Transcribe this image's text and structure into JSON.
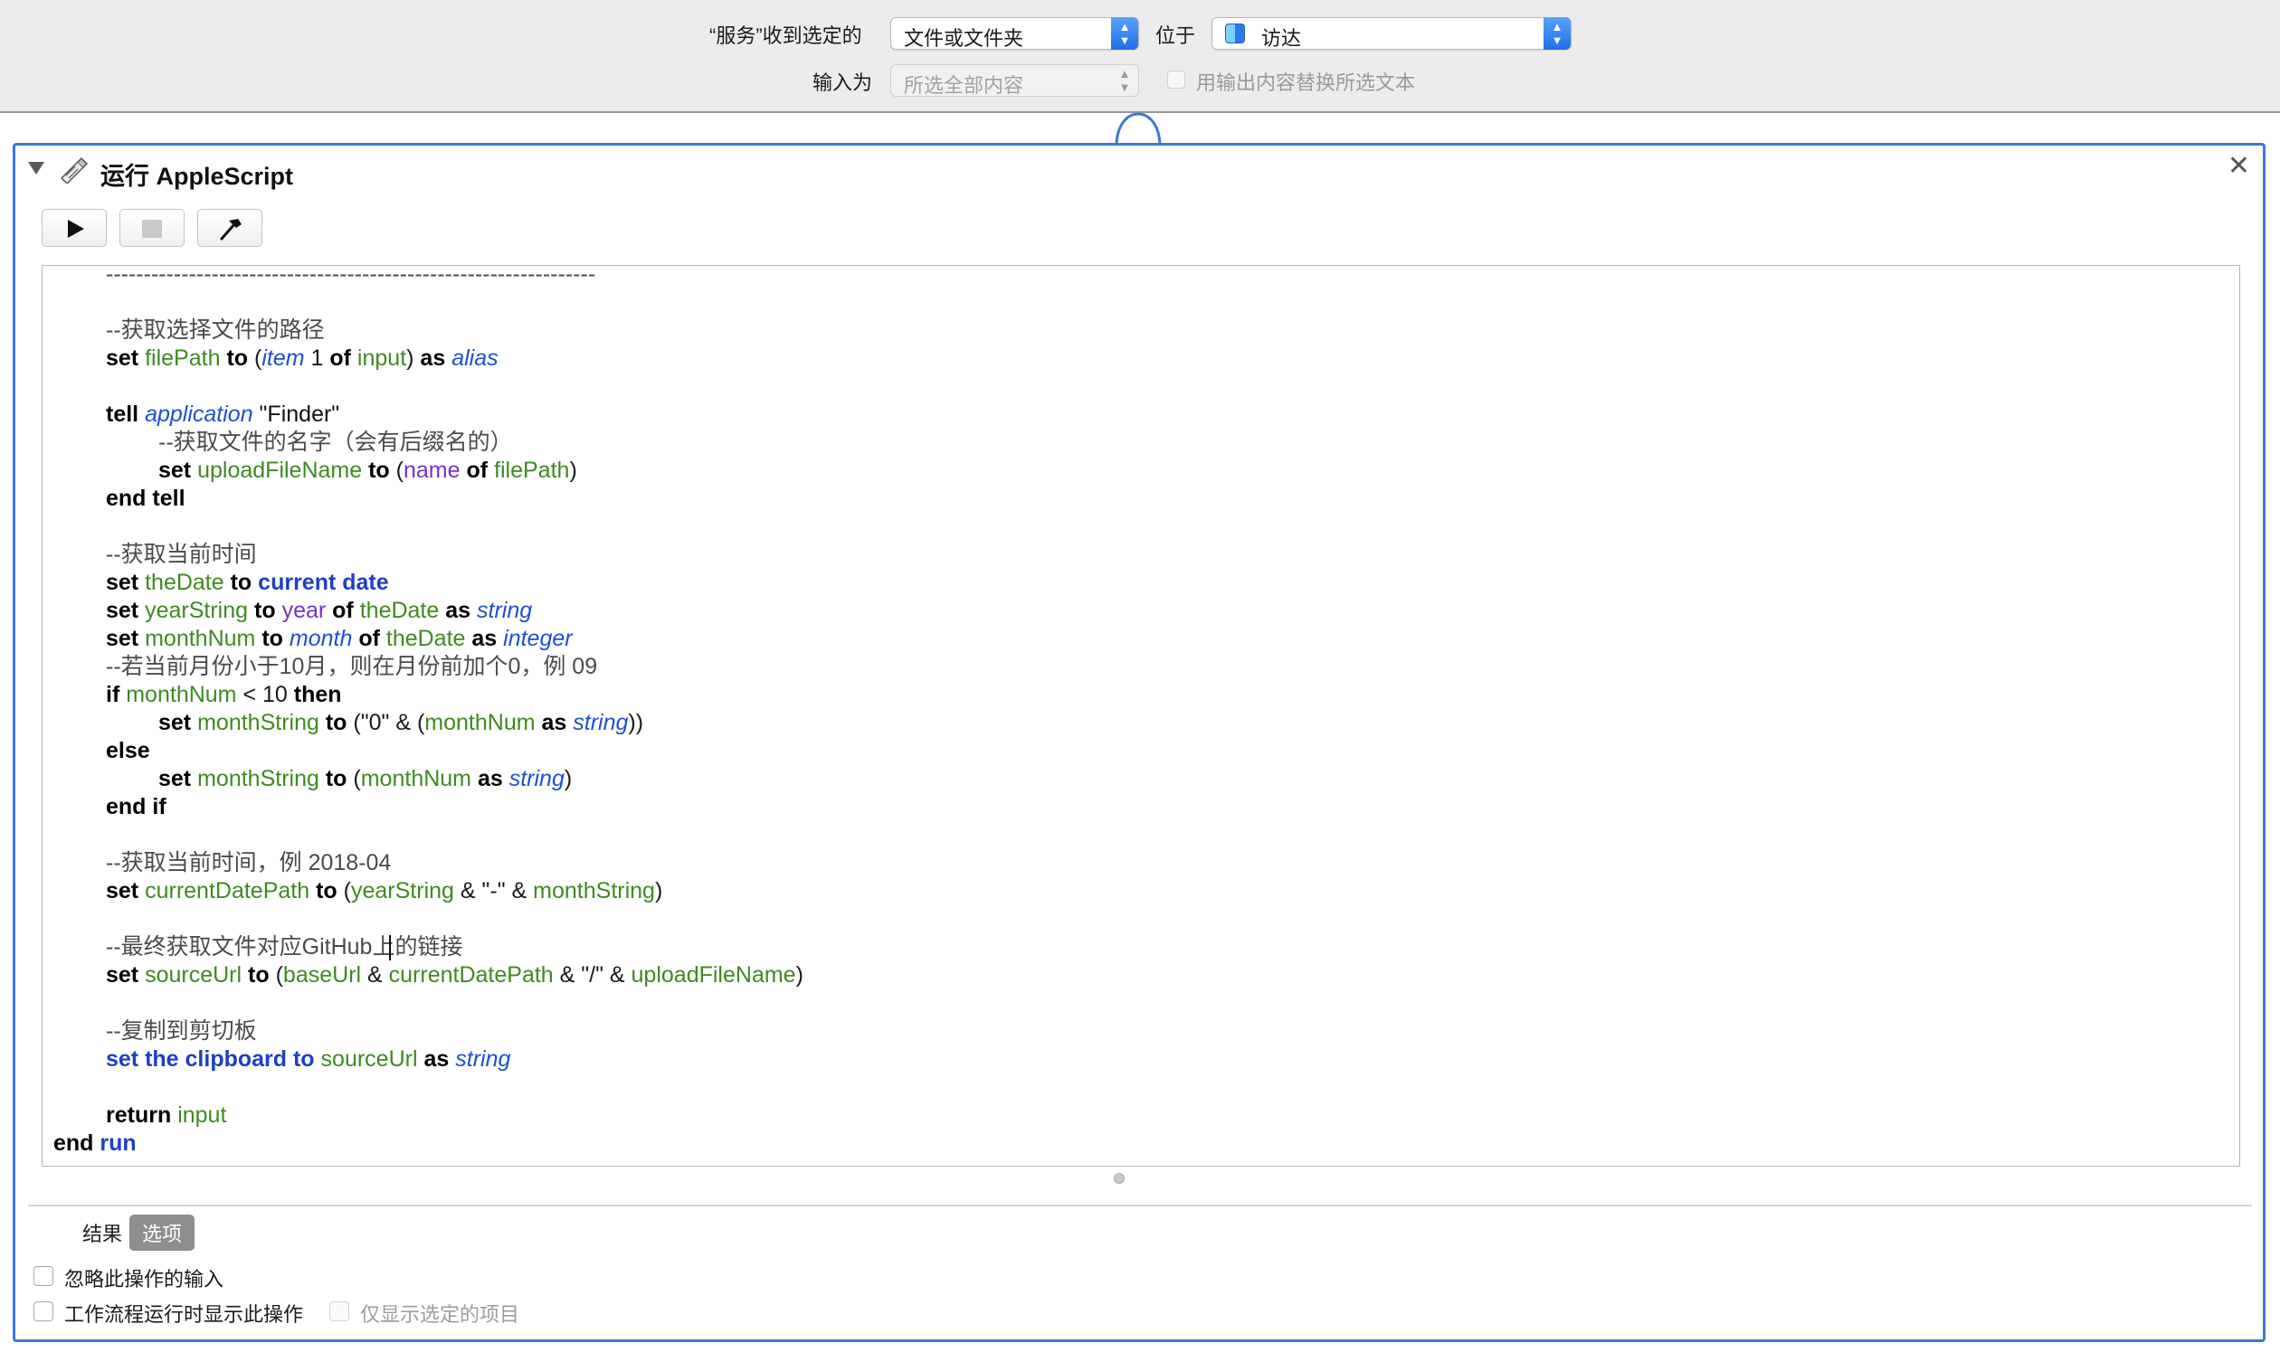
{
  "topbar": {
    "receives_label": "“服务”收到选定的",
    "receives_value": "文件或文件夹",
    "location_label": "位于",
    "location_value": "访达",
    "input_label": "输入为",
    "input_value": "所选全部内容",
    "replace_label": "用输出内容替换所选文本",
    "select_arrows": "▲▼",
    "accent_color": "#2f7cf6"
  },
  "action": {
    "title": "运行 AppleScript",
    "close_glyph": "✕",
    "icon": "script-icon",
    "toolbar": {
      "run_icon": "play-icon",
      "stop_icon": "stop-icon",
      "compile_icon": "hammer-icon"
    }
  },
  "code": {
    "lines": [
      {
        "indent": 1,
        "tokens": [
          {
            "t": "-----------------------------------------------------------------",
            "k": "cmt"
          }
        ]
      },
      {
        "indent": 0,
        "tokens": []
      },
      {
        "indent": 1,
        "tokens": [
          {
            "t": "--获取选择文件的路径",
            "k": "cmt"
          }
        ]
      },
      {
        "indent": 1,
        "tokens": [
          {
            "t": "set",
            "k": "kw"
          },
          {
            "t": " ",
            "k": "plain"
          },
          {
            "t": "filePath",
            "k": "var"
          },
          {
            "t": " ",
            "k": "plain"
          },
          {
            "t": "to",
            "k": "kw"
          },
          {
            "t": " (",
            "k": "plain"
          },
          {
            "t": "item",
            "k": "cls"
          },
          {
            "t": " 1 ",
            "k": "plain"
          },
          {
            "t": "of",
            "k": "kw"
          },
          {
            "t": " ",
            "k": "plain"
          },
          {
            "t": "input",
            "k": "var"
          },
          {
            "t": ") ",
            "k": "plain"
          },
          {
            "t": "as",
            "k": "kw"
          },
          {
            "t": " ",
            "k": "plain"
          },
          {
            "t": "alias",
            "k": "cls"
          }
        ]
      },
      {
        "indent": 0,
        "tokens": []
      },
      {
        "indent": 1,
        "tokens": [
          {
            "t": "tell",
            "k": "kw"
          },
          {
            "t": " ",
            "k": "plain"
          },
          {
            "t": "application",
            "k": "cls"
          },
          {
            "t": " \"Finder\"",
            "k": "str"
          }
        ]
      },
      {
        "indent": 2,
        "tokens": [
          {
            "t": "--获取文件的名字（会有后缀名的）",
            "k": "cmt"
          }
        ]
      },
      {
        "indent": 2,
        "tokens": [
          {
            "t": "set",
            "k": "kw"
          },
          {
            "t": " ",
            "k": "plain"
          },
          {
            "t": "uploadFileName",
            "k": "var"
          },
          {
            "t": " ",
            "k": "plain"
          },
          {
            "t": "to",
            "k": "kw"
          },
          {
            "t": " (",
            "k": "plain"
          },
          {
            "t": "name",
            "k": "prop"
          },
          {
            "t": " ",
            "k": "plain"
          },
          {
            "t": "of",
            "k": "kw"
          },
          {
            "t": " ",
            "k": "plain"
          },
          {
            "t": "filePath",
            "k": "var"
          },
          {
            "t": ")",
            "k": "plain"
          }
        ]
      },
      {
        "indent": 1,
        "tokens": [
          {
            "t": "end tell",
            "k": "kw"
          }
        ]
      },
      {
        "indent": 0,
        "tokens": []
      },
      {
        "indent": 1,
        "tokens": [
          {
            "t": "--获取当前时间",
            "k": "cmt"
          }
        ]
      },
      {
        "indent": 1,
        "tokens": [
          {
            "t": "set",
            "k": "kw"
          },
          {
            "t": " ",
            "k": "plain"
          },
          {
            "t": "theDate",
            "k": "var"
          },
          {
            "t": " ",
            "k": "plain"
          },
          {
            "t": "to",
            "k": "kw"
          },
          {
            "t": " ",
            "k": "plain"
          },
          {
            "t": "current date",
            "k": "cmd"
          }
        ]
      },
      {
        "indent": 1,
        "tokens": [
          {
            "t": "set",
            "k": "kw"
          },
          {
            "t": " ",
            "k": "plain"
          },
          {
            "t": "yearString",
            "k": "var"
          },
          {
            "t": " ",
            "k": "plain"
          },
          {
            "t": "to",
            "k": "kw"
          },
          {
            "t": " ",
            "k": "plain"
          },
          {
            "t": "year",
            "k": "prop"
          },
          {
            "t": " ",
            "k": "plain"
          },
          {
            "t": "of",
            "k": "kw"
          },
          {
            "t": " ",
            "k": "plain"
          },
          {
            "t": "theDate",
            "k": "var"
          },
          {
            "t": " ",
            "k": "plain"
          },
          {
            "t": "as",
            "k": "kw"
          },
          {
            "t": " ",
            "k": "plain"
          },
          {
            "t": "string",
            "k": "cls"
          }
        ]
      },
      {
        "indent": 1,
        "tokens": [
          {
            "t": "set",
            "k": "kw"
          },
          {
            "t": " ",
            "k": "plain"
          },
          {
            "t": "monthNum",
            "k": "var"
          },
          {
            "t": " ",
            "k": "plain"
          },
          {
            "t": "to",
            "k": "kw"
          },
          {
            "t": " ",
            "k": "plain"
          },
          {
            "t": "month",
            "k": "cls"
          },
          {
            "t": " ",
            "k": "plain"
          },
          {
            "t": "of",
            "k": "kw"
          },
          {
            "t": " ",
            "k": "plain"
          },
          {
            "t": "theDate",
            "k": "var"
          },
          {
            "t": " ",
            "k": "plain"
          },
          {
            "t": "as",
            "k": "kw"
          },
          {
            "t": " ",
            "k": "plain"
          },
          {
            "t": "integer",
            "k": "cls"
          }
        ]
      },
      {
        "indent": 1,
        "tokens": [
          {
            "t": "--若当前月份小于10月，则在月份前加个0，例 09",
            "k": "cmt"
          }
        ]
      },
      {
        "indent": 1,
        "tokens": [
          {
            "t": "if",
            "k": "kw"
          },
          {
            "t": " ",
            "k": "plain"
          },
          {
            "t": "monthNum",
            "k": "var"
          },
          {
            "t": " < 10 ",
            "k": "plain"
          },
          {
            "t": "then",
            "k": "kw"
          }
        ]
      },
      {
        "indent": 2,
        "tokens": [
          {
            "t": "set",
            "k": "kw"
          },
          {
            "t": " ",
            "k": "plain"
          },
          {
            "t": "monthString",
            "k": "var"
          },
          {
            "t": " ",
            "k": "plain"
          },
          {
            "t": "to",
            "k": "kw"
          },
          {
            "t": " (\"0\" & (",
            "k": "plain"
          },
          {
            "t": "monthNum",
            "k": "var"
          },
          {
            "t": " ",
            "k": "plain"
          },
          {
            "t": "as",
            "k": "kw"
          },
          {
            "t": " ",
            "k": "plain"
          },
          {
            "t": "string",
            "k": "cls"
          },
          {
            "t": "))",
            "k": "plain"
          }
        ]
      },
      {
        "indent": 1,
        "tokens": [
          {
            "t": "else",
            "k": "kw"
          }
        ]
      },
      {
        "indent": 2,
        "tokens": [
          {
            "t": "set",
            "k": "kw"
          },
          {
            "t": " ",
            "k": "plain"
          },
          {
            "t": "monthString",
            "k": "var"
          },
          {
            "t": " ",
            "k": "plain"
          },
          {
            "t": "to",
            "k": "kw"
          },
          {
            "t": " (",
            "k": "plain"
          },
          {
            "t": "monthNum",
            "k": "var"
          },
          {
            "t": " ",
            "k": "plain"
          },
          {
            "t": "as",
            "k": "kw"
          },
          {
            "t": " ",
            "k": "plain"
          },
          {
            "t": "string",
            "k": "cls"
          },
          {
            "t": ")",
            "k": "plain"
          }
        ]
      },
      {
        "indent": 1,
        "tokens": [
          {
            "t": "end if",
            "k": "kw"
          }
        ]
      },
      {
        "indent": 0,
        "tokens": []
      },
      {
        "indent": 1,
        "tokens": [
          {
            "t": "--获取当前时间，例 2018-04",
            "k": "cmt"
          }
        ]
      },
      {
        "indent": 1,
        "tokens": [
          {
            "t": "set",
            "k": "kw"
          },
          {
            "t": " ",
            "k": "plain"
          },
          {
            "t": "currentDatePath",
            "k": "var"
          },
          {
            "t": " ",
            "k": "plain"
          },
          {
            "t": "to",
            "k": "kw"
          },
          {
            "t": " (",
            "k": "plain"
          },
          {
            "t": "yearString",
            "k": "var"
          },
          {
            "t": " & \"-\" & ",
            "k": "plain"
          },
          {
            "t": "monthString",
            "k": "var"
          },
          {
            "t": ")",
            "k": "plain"
          }
        ]
      },
      {
        "indent": 0,
        "tokens": []
      },
      {
        "indent": 1,
        "tokens": [
          {
            "t": "--最终获取文件对应GitHub上的链接",
            "k": "cmt"
          }
        ]
      },
      {
        "indent": 1,
        "tokens": [
          {
            "t": "set",
            "k": "kw"
          },
          {
            "t": " ",
            "k": "plain"
          },
          {
            "t": "sourceUrl",
            "k": "var"
          },
          {
            "t": " ",
            "k": "plain"
          },
          {
            "t": "to",
            "k": "kw"
          },
          {
            "t": " (",
            "k": "plain"
          },
          {
            "t": "baseUrl",
            "k": "var"
          },
          {
            "t": " & ",
            "k": "plain"
          },
          {
            "t": "currentDatePath",
            "k": "var"
          },
          {
            "t": " & \"/\" & ",
            "k": "plain"
          },
          {
            "t": "uploadFileName",
            "k": "var"
          },
          {
            "t": ")",
            "k": "plain"
          }
        ]
      },
      {
        "indent": 0,
        "tokens": []
      },
      {
        "indent": 1,
        "tokens": [
          {
            "t": "--复制到剪切板",
            "k": "cmt"
          }
        ]
      },
      {
        "indent": 1,
        "tokens": [
          {
            "t": "set the clipboard to",
            "k": "cmd"
          },
          {
            "t": " ",
            "k": "plain"
          },
          {
            "t": "sourceUrl",
            "k": "var"
          },
          {
            "t": " ",
            "k": "plain"
          },
          {
            "t": "as",
            "k": "kw"
          },
          {
            "t": " ",
            "k": "plain"
          },
          {
            "t": "string",
            "k": "cls"
          }
        ]
      },
      {
        "indent": 0,
        "tokens": []
      },
      {
        "indent": 1,
        "tokens": [
          {
            "t": "return",
            "k": "kw"
          },
          {
            "t": " ",
            "k": "plain"
          },
          {
            "t": "input",
            "k": "var"
          }
        ]
      },
      {
        "indent": 0,
        "tokens": [
          {
            "t": "end",
            "k": "kw"
          },
          {
            "t": " ",
            "k": "plain"
          },
          {
            "t": "run",
            "k": "cmd"
          }
        ]
      }
    ]
  },
  "footer": {
    "results_tab": "结果",
    "options_tab": "选项",
    "ignore_input": "忽略此操作的输入",
    "show_when_run": "工作流程运行时显示此操作",
    "show_selected_only": "仅显示选定的项目"
  }
}
